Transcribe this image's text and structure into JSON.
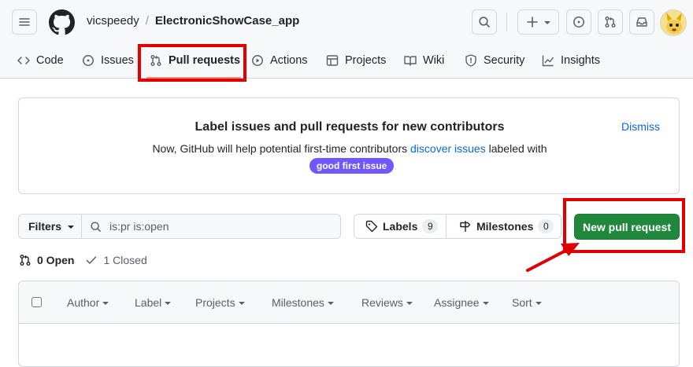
{
  "header": {
    "owner": "vicspeedy",
    "separator": "/",
    "repo": "ElectronicShowCase_app"
  },
  "tabs": [
    {
      "label": "Code",
      "icon": "code-icon"
    },
    {
      "label": "Issues",
      "icon": "issue-opened-icon"
    },
    {
      "label": "Pull requests",
      "icon": "git-pull-request-icon"
    },
    {
      "label": "Actions",
      "icon": "play-icon"
    },
    {
      "label": "Projects",
      "icon": "table-icon"
    },
    {
      "label": "Wiki",
      "icon": "book-icon"
    },
    {
      "label": "Security",
      "icon": "shield-icon"
    },
    {
      "label": "Insights",
      "icon": "graph-icon"
    }
  ],
  "banner": {
    "title": "Label issues and pull requests for new contributors",
    "text_before": "Now, GitHub will help potential first-time contributors ",
    "link": "discover issues",
    "text_after": " labeled with",
    "label": "good first issue",
    "dismiss": "Dismiss"
  },
  "toolbar": {
    "filters": "Filters",
    "search_value": "is:pr is:open",
    "labels": "Labels",
    "labels_count": "9",
    "milestones": "Milestones",
    "milestones_count": "0",
    "new_pr": "New pull request"
  },
  "states": {
    "open": "0 Open",
    "closed": "1 Closed"
  },
  "list_header": {
    "author": "Author",
    "label": "Label",
    "projects": "Projects",
    "milestones": "Milestones",
    "reviews": "Reviews",
    "assignee": "Assignee",
    "sort": "Sort"
  },
  "colors": {
    "primary_button": "#1f883d",
    "link": "#0969da",
    "label_purple": "#7057ff",
    "annotation_red": "#e00000",
    "tab_underline": "#fd8c73"
  }
}
